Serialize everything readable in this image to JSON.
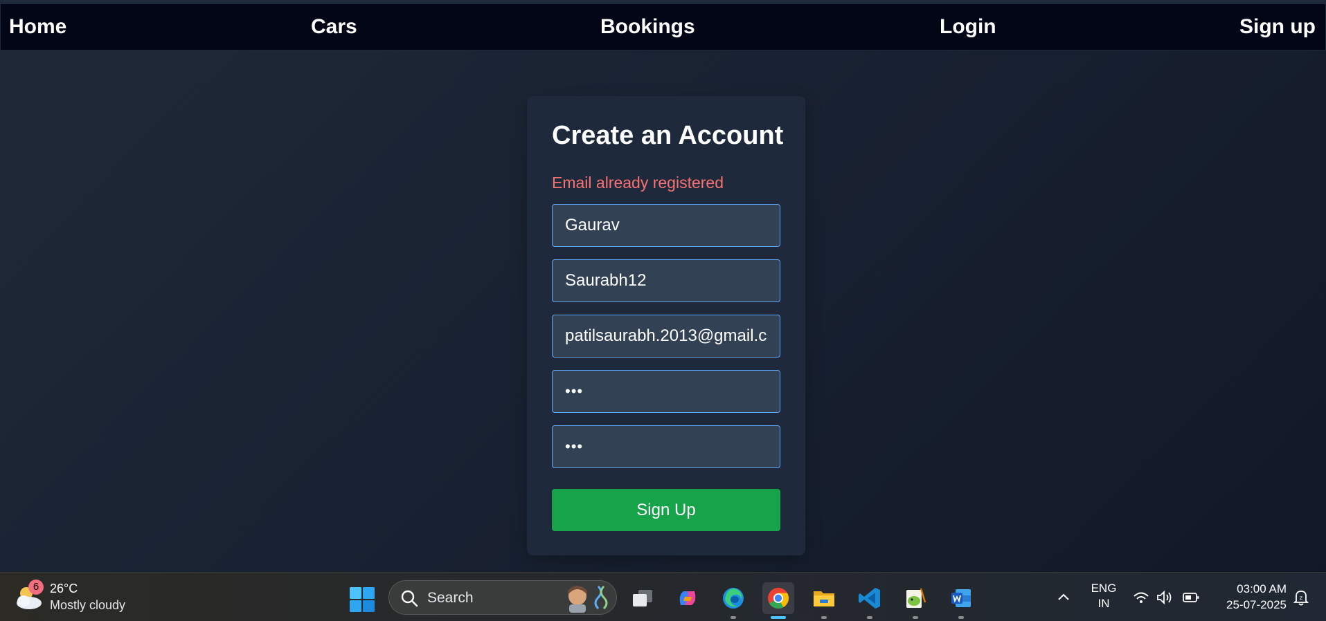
{
  "nav": {
    "home": "Home",
    "cars": "Cars",
    "bookings": "Bookings",
    "login": "Login",
    "signup": "Sign up"
  },
  "form": {
    "title": "Create an Account",
    "error": "Email already registered",
    "name_value": "Gaurav",
    "username_value": "Saurabh12",
    "email_value": "patilsaurabh.2013@gmail.c",
    "password_value": "•••",
    "confirm_password_value": "•••",
    "submit_label": "Sign Up"
  },
  "colors": {
    "error": "#f87171",
    "submit": "#16a34a",
    "input_border": "#60a5fa",
    "card": "#1e293b"
  },
  "taskbar": {
    "weather": {
      "badge": "6",
      "temperature": "26°C",
      "condition": "Mostly cloudy",
      "icon": "cloudy-moon-icon"
    },
    "search_label": "Search",
    "apps": [
      {
        "name": "task-view-icon",
        "active": false,
        "running": false
      },
      {
        "name": "copilot-icon",
        "active": false,
        "running": false
      },
      {
        "name": "edge-icon",
        "active": false,
        "running": true
      },
      {
        "name": "chrome-icon",
        "active": true,
        "running": true
      },
      {
        "name": "file-explorer-icon",
        "active": false,
        "running": true
      },
      {
        "name": "vscode-icon",
        "active": false,
        "running": true
      },
      {
        "name": "notepad-plus-plus-icon",
        "active": false,
        "running": true
      },
      {
        "name": "word-icon",
        "active": false,
        "running": true
      }
    ],
    "lang_top": "ENG",
    "lang_bottom": "IN",
    "time": "03:00 AM",
    "date": "25-07-2025"
  }
}
